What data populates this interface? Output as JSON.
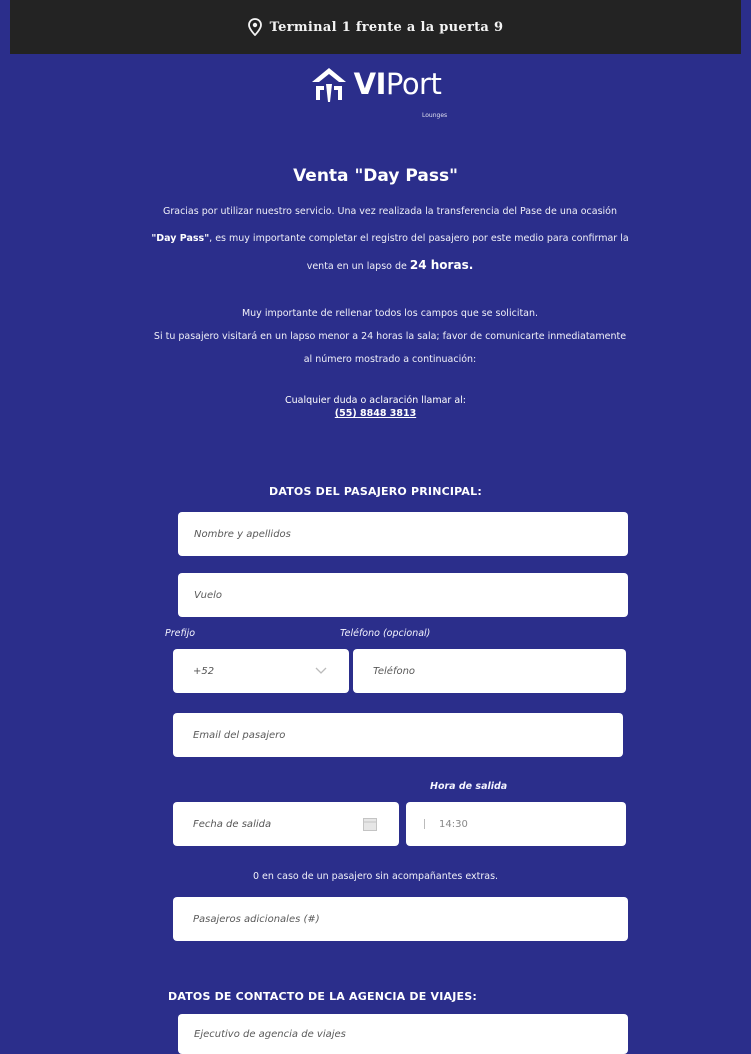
{
  "topbar": {
    "location": "Terminal 1 frente a la puerta 9",
    "icon": "location-pin-icon"
  },
  "logo": {
    "brand_vi": "VI",
    "brand_port": "Port",
    "sub": "Lounges"
  },
  "title": "Venta \"Day Pass\"",
  "intro": {
    "part1": "Gracias por utilizar nuestro servicio. Una vez realizada la transferencia del Pase de una ocasión ",
    "daypass": "\"Day Pass\"",
    "part2": ", es muy importante completar el registro del pasajero por este medio para confirmar la venta en un lapso de ",
    "hours": "24 horas."
  },
  "notice": {
    "line1": "Muy importante de rellenar todos los campos que se solicitan.",
    "line2": "Si tu pasajero visitará en un lapso menor a 24 horas la sala; favor de comunicarte inmediatamente al número mostrado a continuación:"
  },
  "contact": {
    "label": "Cualquier duda o aclaración llamar al:",
    "phone": "(55) 8848 3813"
  },
  "sections": {
    "passenger": "DATOS DEL PASAJERO PRINCIPAL:",
    "agency": "DATOS DE CONTACTO DE LA AGENCIA DE VIAJES:"
  },
  "form": {
    "name_placeholder": "Nombre y apellidos",
    "flight_placeholder": "Vuelo",
    "prefix_label": "Prefijo",
    "phone_label": "Teléfono (opcional)",
    "prefix_value": "+52",
    "phone_placeholder": "Teléfono",
    "email_placeholder": "Email del pasajero",
    "departure_time_label": "Hora de salida",
    "departure_date_placeholder": "Fecha de salida",
    "departure_time_value": "14:30",
    "extra_note": "0 en caso de un pasajero sin acompañantes extras.",
    "additional_placeholder": "Pasajeros adicionales (#)",
    "agent_placeholder": "Ejecutivo de agencia de viajes"
  },
  "colors": {
    "background": "#2b2e8b",
    "topbar": "#232323",
    "field": "#ffffff"
  }
}
